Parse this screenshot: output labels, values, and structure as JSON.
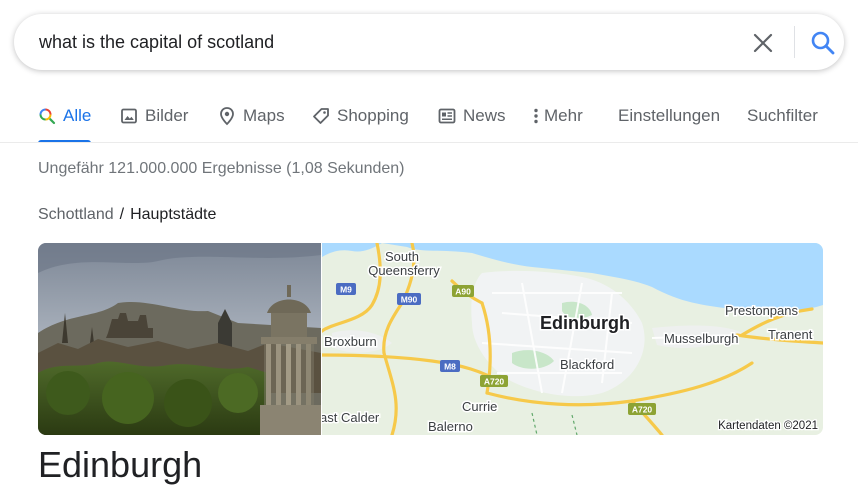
{
  "search": {
    "query": "what is the capital of scotland"
  },
  "tabs": [
    {
      "label": "Alle",
      "icon": "search-icon",
      "active": true
    },
    {
      "label": "Bilder",
      "icon": "image-icon"
    },
    {
      "label": "Maps",
      "icon": "map-pin-icon"
    },
    {
      "label": "Shopping",
      "icon": "tag-icon"
    },
    {
      "label": "News",
      "icon": "newspaper-icon"
    },
    {
      "label": "Mehr",
      "icon": "more-vert-icon"
    },
    {
      "label": "Einstellungen"
    },
    {
      "label": "Suchfilter"
    }
  ],
  "results": {
    "stats": "Ungefähr 121.000.000 Ergebnisse (1,08 Sekunden)"
  },
  "breadcrumb": {
    "parent": "Schottland",
    "separator": "/",
    "current": "Hauptstädte"
  },
  "map": {
    "city": "Edinburgh",
    "places": {
      "south": "South",
      "queensferry": "Queensferry",
      "broxburn": "Broxburn",
      "blackford": "Blackford",
      "currie": "Currie",
      "east_calder": "ast Calder",
      "balerno": "Balerno",
      "musselburgh": "Musselburgh",
      "prestonpans": "Prestonpans",
      "tranent": "Tranent"
    },
    "roads": {
      "m9": "M9",
      "m90": "M90",
      "a90": "A90",
      "m8": "M8",
      "a720_west": "A720",
      "a720_east": "A720"
    },
    "attribution": "Kartendaten ©2021"
  },
  "entity": {
    "title": "Edinburgh"
  },
  "colors": {
    "accent": "#1a73e8",
    "water": "#aadaff",
    "land": "#e8f0e2",
    "motorway": "#f6c94a",
    "road_shield_blue": "#4b6cc2",
    "road_shield_green": "#8da334"
  }
}
